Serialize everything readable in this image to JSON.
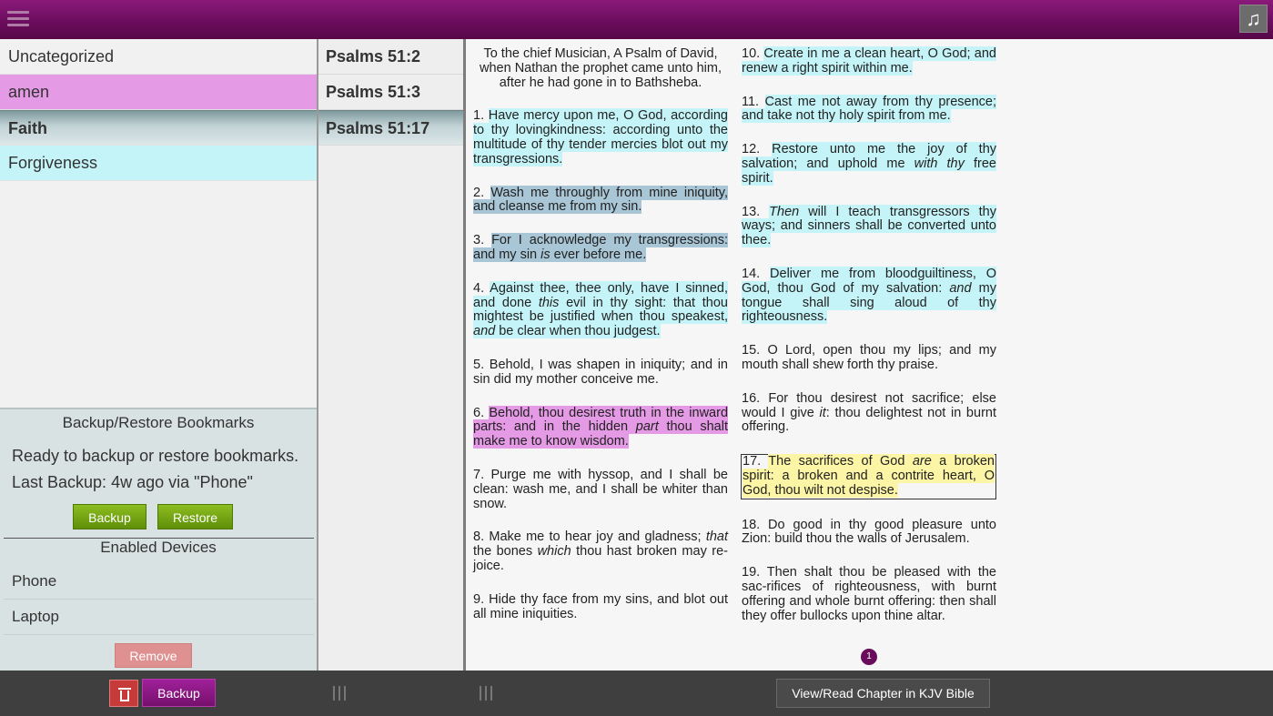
{
  "topbar": {
    "menu_icon": "hamburger-icon",
    "music_icon": "music-note-icon",
    "music_glyph": "♫"
  },
  "categories": [
    {
      "label": "Uncategorized"
    },
    {
      "label": "amen"
    },
    {
      "label": "Faith"
    },
    {
      "label": "Forgiveness"
    }
  ],
  "backup": {
    "title": "Backup/Restore Bookmarks",
    "status": "Ready to backup or restore bookmarks.",
    "last_backup": "Last Backup: 4w ago via \"Phone\"",
    "backup_label": "Backup",
    "restore_label": "Restore",
    "devices_title": "Enabled Devices",
    "devices": [
      "Phone",
      "Laptop"
    ],
    "remove_label": "Remove"
  },
  "references": [
    {
      "label": "Psalms 51:2"
    },
    {
      "label": "Psalms 51:3"
    },
    {
      "label": "Psalms 51:17"
    }
  ],
  "chapter": {
    "intro": "To the chief Musician, A Psalm of David, when Nathan the prophet came unto him, after he had gone in to Bathsheba.",
    "page_number": "1"
  },
  "colors": {
    "amen": "#e59ae6",
    "forgiveness": "#c5f4f8",
    "faith": "#a9c6d6",
    "highlight_yellow": "#fdf5a6",
    "accent": "#6a0c5c"
  },
  "bottombar": {
    "trash_icon": "trash-icon",
    "backup_label": "Backup",
    "view_label": "View/Read Chapter in KJV Bible"
  }
}
